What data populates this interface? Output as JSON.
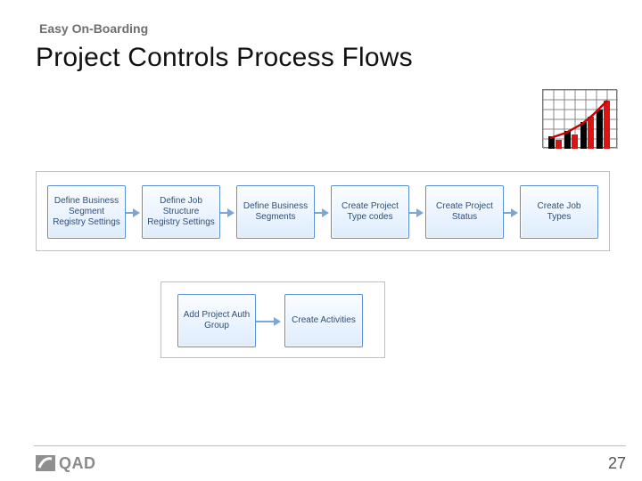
{
  "header": {
    "subtitle": "Easy On-Boarding",
    "title": "Project Controls Process Flows"
  },
  "flow": {
    "row1": [
      "Define Business Segment Registry Settings",
      "Define Job Structure Registry Settings",
      "Define Business Segments",
      "Create Project Type codes",
      "Create Project Status",
      "Create Job Types"
    ],
    "row2": [
      "Add Project Auth Group",
      "Create Activities"
    ]
  },
  "footer": {
    "logo_text": "QAD",
    "page_number": "27"
  }
}
